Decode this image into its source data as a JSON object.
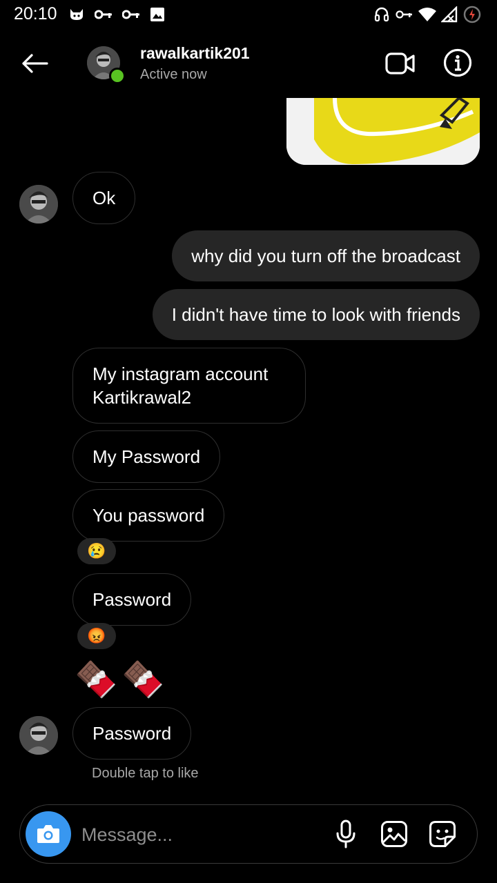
{
  "status_bar": {
    "time": "20:10",
    "icons_left": [
      "cat-icon",
      "key-icon",
      "key-icon",
      "image-icon"
    ],
    "icons_right": [
      "headphones-icon",
      "vpn-key-icon",
      "wifi-icon",
      "signal-icon",
      "battery-saver-icon"
    ]
  },
  "header": {
    "username": "rawalkartik201",
    "status": "Active now",
    "online_color": "#58c322"
  },
  "messages": [
    {
      "side": "out",
      "type": "image-partial"
    },
    {
      "side": "in",
      "text": "Ok",
      "avatar": true
    },
    {
      "side": "out",
      "text": "why did you turn off the broadcast"
    },
    {
      "side": "out",
      "text": "I didn't have time to look with friends"
    },
    {
      "side": "in",
      "text_line1": "My instagram account",
      "text_line2": "Kartikrawal2"
    },
    {
      "side": "in",
      "text": "My Password"
    },
    {
      "side": "in",
      "text": "You password",
      "reaction": "😢"
    },
    {
      "side": "in",
      "text": "Password",
      "reaction": "😡"
    },
    {
      "side": "in",
      "text": "🍫🍫",
      "type": "emoji"
    },
    {
      "side": "in",
      "text": "Password",
      "avatar": true
    }
  ],
  "hint": "Double tap to like",
  "composer": {
    "placeholder": "Message...",
    "accent": "#3897f0"
  }
}
